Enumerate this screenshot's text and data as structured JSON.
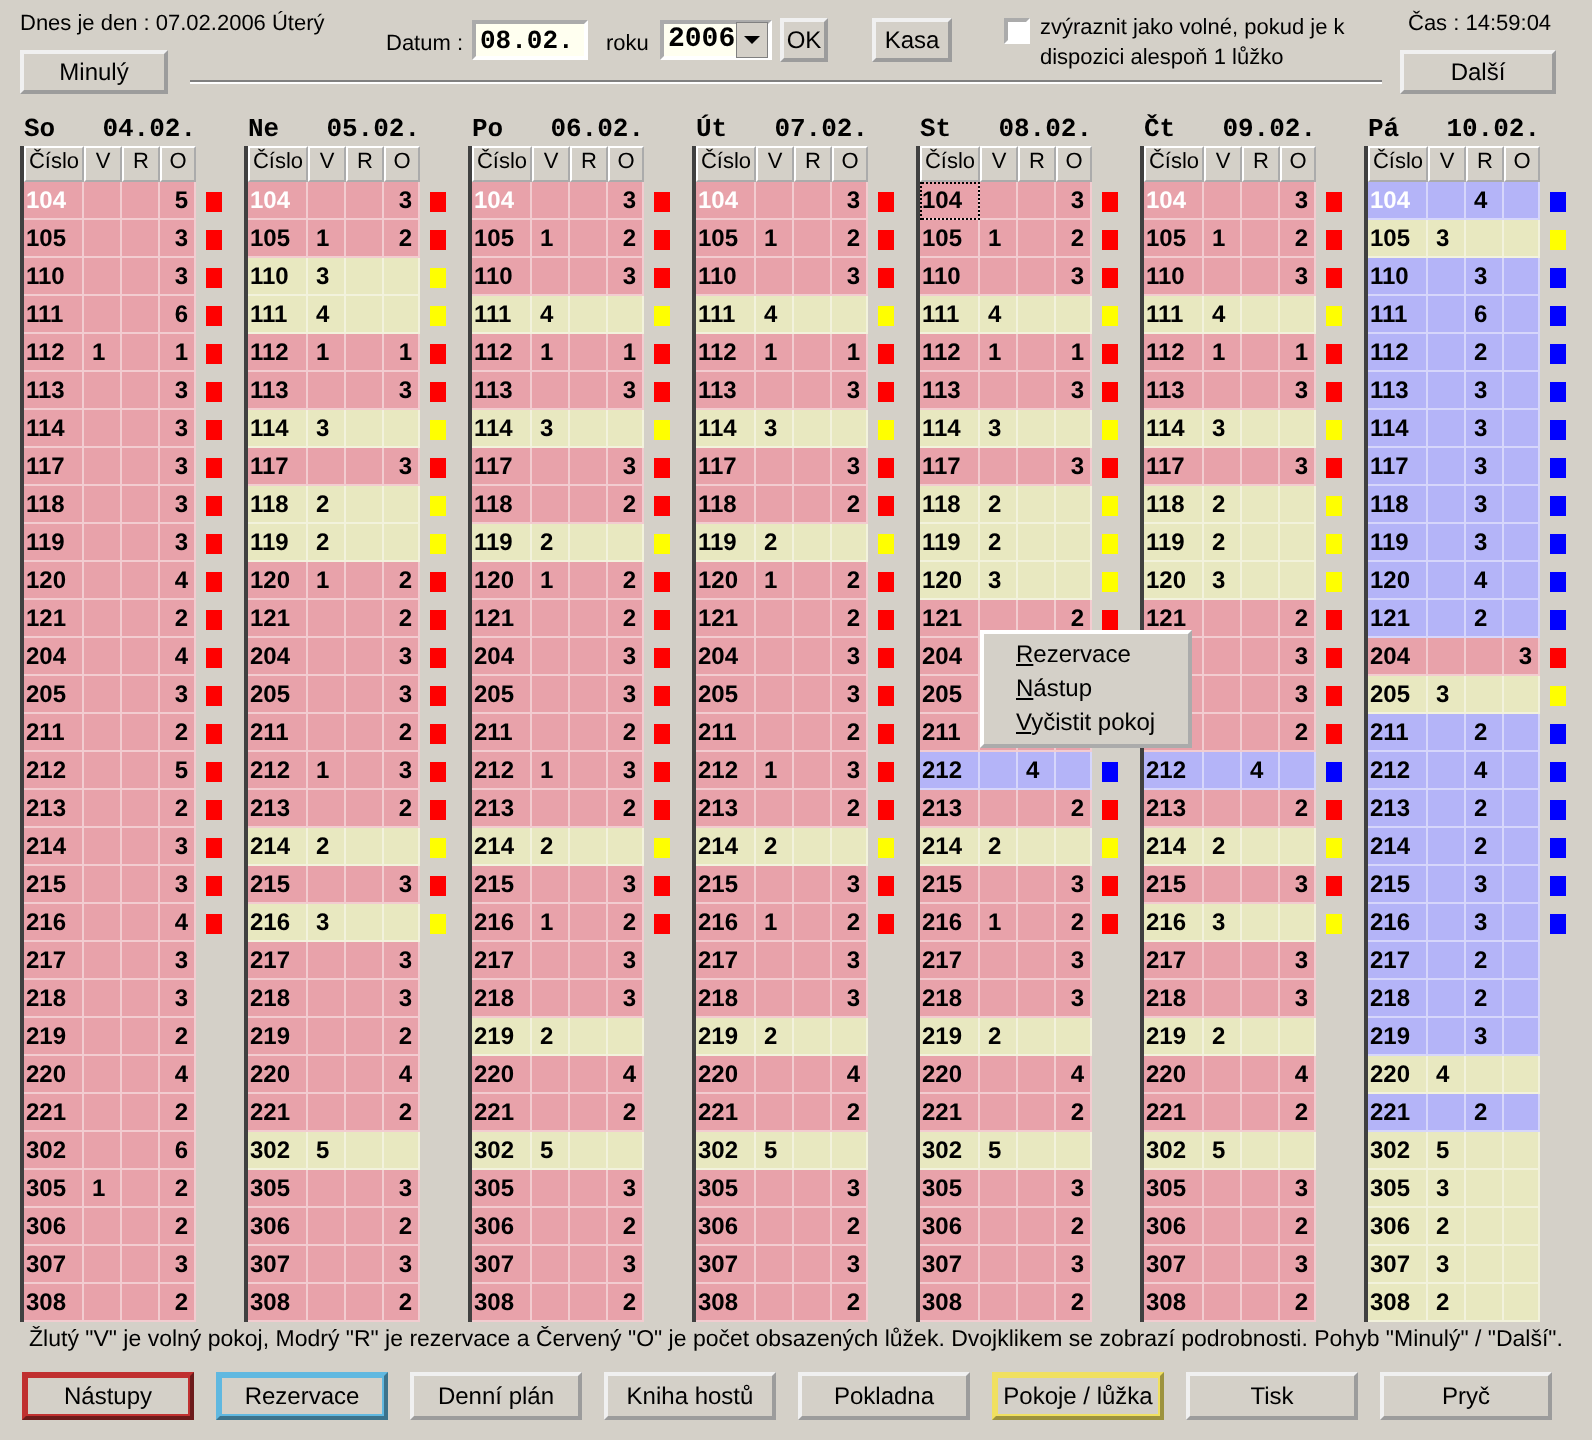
{
  "header": {
    "today": "Dnes je den : 07.02.2006  Úterý",
    "date_label": "Datum :",
    "date_value": "08.02.",
    "year_label": "roku",
    "year_value": "2006",
    "ok": "OK",
    "kasa": "Kasa",
    "highlight_checkbox": {
      "label": "zvýraznit jako volné, pokud je k dispozici alespoň 1 lůžko",
      "checked": false
    },
    "time": "Čas : 14:59:04",
    "prev": "Minulý",
    "next": "Další"
  },
  "days": [
    {
      "name": "So",
      "date": "04.02.",
      "columns": [
        "Číslo",
        "V",
        "R",
        "O"
      ],
      "rows": [
        {
          "room": "104",
          "o": "5",
          "kind": "occupied",
          "selected": true,
          "focused": false,
          "marker": true
        },
        {
          "room": "105",
          "o": "3",
          "kind": "occupied",
          "selected": false,
          "focused": false,
          "marker": true
        },
        {
          "room": "110",
          "o": "3",
          "kind": "occupied",
          "selected": false,
          "focused": false,
          "marker": true
        },
        {
          "room": "111",
          "o": "6",
          "kind": "occupied",
          "selected": false,
          "focused": false,
          "marker": true
        },
        {
          "room": "112",
          "v": "1",
          "o": "1",
          "kind": "occupied",
          "selected": false,
          "focused": false,
          "marker": true
        },
        {
          "room": "113",
          "o": "3",
          "kind": "occupied",
          "selected": false,
          "focused": false,
          "marker": true
        },
        {
          "room": "114",
          "o": "3",
          "kind": "occupied",
          "selected": false,
          "focused": false,
          "marker": true
        },
        {
          "room": "117",
          "o": "3",
          "kind": "occupied",
          "selected": false,
          "focused": false,
          "marker": true
        },
        {
          "room": "118",
          "o": "3",
          "kind": "occupied",
          "selected": false,
          "focused": false,
          "marker": true
        },
        {
          "room": "119",
          "o": "3",
          "kind": "occupied",
          "selected": false,
          "focused": false,
          "marker": true
        },
        {
          "room": "120",
          "o": "4",
          "kind": "occupied",
          "selected": false,
          "focused": false,
          "marker": true
        },
        {
          "room": "121",
          "o": "2",
          "kind": "occupied",
          "selected": false,
          "focused": false,
          "marker": true
        },
        {
          "room": "204",
          "o": "4",
          "kind": "occupied",
          "selected": false,
          "focused": false,
          "marker": true
        },
        {
          "room": "205",
          "o": "3",
          "kind": "occupied",
          "selected": false,
          "focused": false,
          "marker": true
        },
        {
          "room": "211",
          "o": "2",
          "kind": "occupied",
          "selected": false,
          "focused": false,
          "marker": true
        },
        {
          "room": "212",
          "o": "5",
          "kind": "occupied",
          "selected": false,
          "focused": false,
          "marker": true
        },
        {
          "room": "213",
          "o": "2",
          "kind": "occupied",
          "selected": false,
          "focused": false,
          "marker": true
        },
        {
          "room": "214",
          "o": "3",
          "kind": "occupied",
          "selected": false,
          "focused": false,
          "marker": true
        },
        {
          "room": "215",
          "o": "3",
          "kind": "occupied",
          "selected": false,
          "focused": false,
          "marker": true
        },
        {
          "room": "216",
          "o": "4",
          "kind": "occupied",
          "selected": false,
          "focused": false,
          "marker": true
        },
        {
          "room": "217",
          "o": "3",
          "kind": "occupied",
          "selected": false,
          "focused": false,
          "marker": false
        },
        {
          "room": "218",
          "o": "3",
          "kind": "occupied",
          "selected": false,
          "focused": false,
          "marker": false
        },
        {
          "room": "219",
          "o": "2",
          "kind": "occupied",
          "selected": false,
          "focused": false,
          "marker": false
        },
        {
          "room": "220",
          "o": "4",
          "kind": "occupied",
          "selected": false,
          "focused": false,
          "marker": false
        },
        {
          "room": "221",
          "o": "2",
          "kind": "occupied",
          "selected": false,
          "focused": false,
          "marker": false
        },
        {
          "room": "302",
          "o": "6",
          "kind": "occupied",
          "selected": false,
          "focused": false,
          "marker": false
        },
        {
          "room": "305",
          "v": "1",
          "o": "2",
          "kind": "occupied",
          "selected": false,
          "focused": false,
          "marker": false
        },
        {
          "room": "306",
          "o": "2",
          "kind": "occupied",
          "selected": false,
          "focused": false,
          "marker": false
        },
        {
          "room": "307",
          "o": "3",
          "kind": "occupied",
          "selected": false,
          "focused": false,
          "marker": false
        },
        {
          "room": "308",
          "o": "2",
          "kind": "occupied",
          "selected": false,
          "focused": false,
          "marker": false
        }
      ]
    },
    {
      "name": "Ne",
      "date": "05.02.",
      "columns": [
        "Číslo",
        "V",
        "R",
        "O"
      ],
      "rows": [
        {
          "room": "104",
          "o": "3",
          "kind": "occupied",
          "selected": true,
          "focused": false,
          "marker": true
        },
        {
          "room": "105",
          "v": "1",
          "o": "2",
          "kind": "occupied",
          "selected": false,
          "focused": false,
          "marker": true
        },
        {
          "room": "110",
          "v": "3",
          "kind": "free",
          "selected": false,
          "focused": false,
          "marker": true
        },
        {
          "room": "111",
          "v": "4",
          "kind": "free",
          "selected": false,
          "focused": false,
          "marker": true
        },
        {
          "room": "112",
          "v": "1",
          "o": "1",
          "kind": "occupied",
          "selected": false,
          "focused": false,
          "marker": true
        },
        {
          "room": "113",
          "o": "3",
          "kind": "occupied",
          "selected": false,
          "focused": false,
          "marker": true
        },
        {
          "room": "114",
          "v": "3",
          "kind": "free",
          "selected": false,
          "focused": false,
          "marker": true
        },
        {
          "room": "117",
          "o": "3",
          "kind": "occupied",
          "selected": false,
          "focused": false,
          "marker": true
        },
        {
          "room": "118",
          "v": "2",
          "kind": "free",
          "selected": false,
          "focused": false,
          "marker": true
        },
        {
          "room": "119",
          "v": "2",
          "kind": "free",
          "selected": false,
          "focused": false,
          "marker": true
        },
        {
          "room": "120",
          "v": "1",
          "o": "2",
          "kind": "occupied",
          "selected": false,
          "focused": false,
          "marker": true
        },
        {
          "room": "121",
          "o": "2",
          "kind": "occupied",
          "selected": false,
          "focused": false,
          "marker": true
        },
        {
          "room": "204",
          "o": "3",
          "kind": "occupied",
          "selected": false,
          "focused": false,
          "marker": true
        },
        {
          "room": "205",
          "o": "3",
          "kind": "occupied",
          "selected": false,
          "focused": false,
          "marker": true
        },
        {
          "room": "211",
          "o": "2",
          "kind": "occupied",
          "selected": false,
          "focused": false,
          "marker": true
        },
        {
          "room": "212",
          "v": "1",
          "o": "3",
          "kind": "occupied",
          "selected": false,
          "focused": false,
          "marker": true
        },
        {
          "room": "213",
          "o": "2",
          "kind": "occupied",
          "selected": false,
          "focused": false,
          "marker": true
        },
        {
          "room": "214",
          "v": "2",
          "kind": "free",
          "selected": false,
          "focused": false,
          "marker": true
        },
        {
          "room": "215",
          "o": "3",
          "kind": "occupied",
          "selected": false,
          "focused": false,
          "marker": true
        },
        {
          "room": "216",
          "v": "3",
          "kind": "free",
          "selected": false,
          "focused": false,
          "marker": true
        },
        {
          "room": "217",
          "o": "3",
          "kind": "occupied",
          "selected": false,
          "focused": false,
          "marker": false
        },
        {
          "room": "218",
          "o": "3",
          "kind": "occupied",
          "selected": false,
          "focused": false,
          "marker": false
        },
        {
          "room": "219",
          "o": "2",
          "kind": "occupied",
          "selected": false,
          "focused": false,
          "marker": false
        },
        {
          "room": "220",
          "o": "4",
          "kind": "occupied",
          "selected": false,
          "focused": false,
          "marker": false
        },
        {
          "room": "221",
          "o": "2",
          "kind": "occupied",
          "selected": false,
          "focused": false,
          "marker": false
        },
        {
          "room": "302",
          "v": "5",
          "kind": "free",
          "selected": false,
          "focused": false,
          "marker": false
        },
        {
          "room": "305",
          "o": "3",
          "kind": "occupied",
          "selected": false,
          "focused": false,
          "marker": false
        },
        {
          "room": "306",
          "o": "2",
          "kind": "occupied",
          "selected": false,
          "focused": false,
          "marker": false
        },
        {
          "room": "307",
          "o": "3",
          "kind": "occupied",
          "selected": false,
          "focused": false,
          "marker": false
        },
        {
          "room": "308",
          "o": "2",
          "kind": "occupied",
          "selected": false,
          "focused": false,
          "marker": false
        }
      ]
    },
    {
      "name": "Po",
      "date": "06.02.",
      "columns": [
        "Číslo",
        "V",
        "R",
        "O"
      ],
      "rows": [
        {
          "room": "104",
          "o": "3",
          "kind": "occupied",
          "selected": true,
          "focused": false,
          "marker": true
        },
        {
          "room": "105",
          "v": "1",
          "o": "2",
          "kind": "occupied",
          "selected": false,
          "focused": false,
          "marker": true
        },
        {
          "room": "110",
          "o": "3",
          "kind": "occupied",
          "selected": false,
          "focused": false,
          "marker": true
        },
        {
          "room": "111",
          "v": "4",
          "kind": "free",
          "selected": false,
          "focused": false,
          "marker": true
        },
        {
          "room": "112",
          "v": "1",
          "o": "1",
          "kind": "occupied",
          "selected": false,
          "focused": false,
          "marker": true
        },
        {
          "room": "113",
          "o": "3",
          "kind": "occupied",
          "selected": false,
          "focused": false,
          "marker": true
        },
        {
          "room": "114",
          "v": "3",
          "kind": "free",
          "selected": false,
          "focused": false,
          "marker": true
        },
        {
          "room": "117",
          "o": "3",
          "kind": "occupied",
          "selected": false,
          "focused": false,
          "marker": true
        },
        {
          "room": "118",
          "o": "2",
          "kind": "occupied",
          "selected": false,
          "focused": false,
          "marker": true
        },
        {
          "room": "119",
          "v": "2",
          "kind": "free",
          "selected": false,
          "focused": false,
          "marker": true
        },
        {
          "room": "120",
          "v": "1",
          "o": "2",
          "kind": "occupied",
          "selected": false,
          "focused": false,
          "marker": true
        },
        {
          "room": "121",
          "o": "2",
          "kind": "occupied",
          "selected": false,
          "focused": false,
          "marker": true
        },
        {
          "room": "204",
          "o": "3",
          "kind": "occupied",
          "selected": false,
          "focused": false,
          "marker": true
        },
        {
          "room": "205",
          "o": "3",
          "kind": "occupied",
          "selected": false,
          "focused": false,
          "marker": true
        },
        {
          "room": "211",
          "o": "2",
          "kind": "occupied",
          "selected": false,
          "focused": false,
          "marker": true
        },
        {
          "room": "212",
          "v": "1",
          "o": "3",
          "kind": "occupied",
          "selected": false,
          "focused": false,
          "marker": true
        },
        {
          "room": "213",
          "o": "2",
          "kind": "occupied",
          "selected": false,
          "focused": false,
          "marker": true
        },
        {
          "room": "214",
          "v": "2",
          "kind": "free",
          "selected": false,
          "focused": false,
          "marker": true
        },
        {
          "room": "215",
          "o": "3",
          "kind": "occupied",
          "selected": false,
          "focused": false,
          "marker": true
        },
        {
          "room": "216",
          "v": "1",
          "o": "2",
          "kind": "occupied",
          "selected": false,
          "focused": false,
          "marker": true
        },
        {
          "room": "217",
          "o": "3",
          "kind": "occupied",
          "selected": false,
          "focused": false,
          "marker": false
        },
        {
          "room": "218",
          "o": "3",
          "kind": "occupied",
          "selected": false,
          "focused": false,
          "marker": false
        },
        {
          "room": "219",
          "v": "2",
          "kind": "free",
          "selected": false,
          "focused": false,
          "marker": false
        },
        {
          "room": "220",
          "o": "4",
          "kind": "occupied",
          "selected": false,
          "focused": false,
          "marker": false
        },
        {
          "room": "221",
          "o": "2",
          "kind": "occupied",
          "selected": false,
          "focused": false,
          "marker": false
        },
        {
          "room": "302",
          "v": "5",
          "kind": "free",
          "selected": false,
          "focused": false,
          "marker": false
        },
        {
          "room": "305",
          "o": "3",
          "kind": "occupied",
          "selected": false,
          "focused": false,
          "marker": false
        },
        {
          "room": "306",
          "o": "2",
          "kind": "occupied",
          "selected": false,
          "focused": false,
          "marker": false
        },
        {
          "room": "307",
          "o": "3",
          "kind": "occupied",
          "selected": false,
          "focused": false,
          "marker": false
        },
        {
          "room": "308",
          "o": "2",
          "kind": "occupied",
          "selected": false,
          "focused": false,
          "marker": false
        }
      ]
    },
    {
      "name": "Út",
      "date": "07.02.",
      "columns": [
        "Číslo",
        "V",
        "R",
        "O"
      ],
      "rows": [
        {
          "room": "104",
          "o": "3",
          "kind": "occupied",
          "selected": true,
          "focused": false,
          "marker": true
        },
        {
          "room": "105",
          "v": "1",
          "o": "2",
          "kind": "occupied",
          "selected": false,
          "focused": false,
          "marker": true
        },
        {
          "room": "110",
          "o": "3",
          "kind": "occupied",
          "selected": false,
          "focused": false,
          "marker": true
        },
        {
          "room": "111",
          "v": "4",
          "kind": "free",
          "selected": false,
          "focused": false,
          "marker": true
        },
        {
          "room": "112",
          "v": "1",
          "o": "1",
          "kind": "occupied",
          "selected": false,
          "focused": false,
          "marker": true
        },
        {
          "room": "113",
          "o": "3",
          "kind": "occupied",
          "selected": false,
          "focused": false,
          "marker": true
        },
        {
          "room": "114",
          "v": "3",
          "kind": "free",
          "selected": false,
          "focused": false,
          "marker": true
        },
        {
          "room": "117",
          "o": "3",
          "kind": "occupied",
          "selected": false,
          "focused": false,
          "marker": true
        },
        {
          "room": "118",
          "o": "2",
          "kind": "occupied",
          "selected": false,
          "focused": false,
          "marker": true
        },
        {
          "room": "119",
          "v": "2",
          "kind": "free",
          "selected": false,
          "focused": false,
          "marker": true
        },
        {
          "room": "120",
          "v": "1",
          "o": "2",
          "kind": "occupied",
          "selected": false,
          "focused": false,
          "marker": true
        },
        {
          "room": "121",
          "o": "2",
          "kind": "occupied",
          "selected": false,
          "focused": false,
          "marker": true
        },
        {
          "room": "204",
          "o": "3",
          "kind": "occupied",
          "selected": false,
          "focused": false,
          "marker": true
        },
        {
          "room": "205",
          "o": "3",
          "kind": "occupied",
          "selected": false,
          "focused": false,
          "marker": true
        },
        {
          "room": "211",
          "o": "2",
          "kind": "occupied",
          "selected": false,
          "focused": false,
          "marker": true
        },
        {
          "room": "212",
          "v": "1",
          "o": "3",
          "kind": "occupied",
          "selected": false,
          "focused": false,
          "marker": true
        },
        {
          "room": "213",
          "o": "2",
          "kind": "occupied",
          "selected": false,
          "focused": false,
          "marker": true
        },
        {
          "room": "214",
          "v": "2",
          "kind": "free",
          "selected": false,
          "focused": false,
          "marker": true
        },
        {
          "room": "215",
          "o": "3",
          "kind": "occupied",
          "selected": false,
          "focused": false,
          "marker": true
        },
        {
          "room": "216",
          "v": "1",
          "o": "2",
          "kind": "occupied",
          "selected": false,
          "focused": false,
          "marker": true
        },
        {
          "room": "217",
          "o": "3",
          "kind": "occupied",
          "selected": false,
          "focused": false,
          "marker": false
        },
        {
          "room": "218",
          "o": "3",
          "kind": "occupied",
          "selected": false,
          "focused": false,
          "marker": false
        },
        {
          "room": "219",
          "v": "2",
          "kind": "free",
          "selected": false,
          "focused": false,
          "marker": false
        },
        {
          "room": "220",
          "o": "4",
          "kind": "occupied",
          "selected": false,
          "focused": false,
          "marker": false
        },
        {
          "room": "221",
          "o": "2",
          "kind": "occupied",
          "selected": false,
          "focused": false,
          "marker": false
        },
        {
          "room": "302",
          "v": "5",
          "kind": "free",
          "selected": false,
          "focused": false,
          "marker": false
        },
        {
          "room": "305",
          "o": "3",
          "kind": "occupied",
          "selected": false,
          "focused": false,
          "marker": false
        },
        {
          "room": "306",
          "o": "2",
          "kind": "occupied",
          "selected": false,
          "focused": false,
          "marker": false
        },
        {
          "room": "307",
          "o": "3",
          "kind": "occupied",
          "selected": false,
          "focused": false,
          "marker": false
        },
        {
          "room": "308",
          "o": "2",
          "kind": "occupied",
          "selected": false,
          "focused": false,
          "marker": false
        }
      ]
    },
    {
      "name": "St",
      "date": "08.02.",
      "columns": [
        "Číslo",
        "V",
        "R",
        "O"
      ],
      "rows": [
        {
          "room": "104",
          "o": "3",
          "kind": "occupied",
          "selected": false,
          "focused": true,
          "marker": true
        },
        {
          "room": "105",
          "v": "1",
          "o": "2",
          "kind": "occupied",
          "selected": false,
          "focused": false,
          "marker": true
        },
        {
          "room": "110",
          "o": "3",
          "kind": "occupied",
          "selected": false,
          "focused": false,
          "marker": true
        },
        {
          "room": "111",
          "v": "4",
          "kind": "free",
          "selected": false,
          "focused": false,
          "marker": true
        },
        {
          "room": "112",
          "v": "1",
          "o": "1",
          "kind": "occupied",
          "selected": false,
          "focused": false,
          "marker": true
        },
        {
          "room": "113",
          "o": "3",
          "kind": "occupied",
          "selected": false,
          "focused": false,
          "marker": true
        },
        {
          "room": "114",
          "v": "3",
          "kind": "free",
          "selected": false,
          "focused": false,
          "marker": true
        },
        {
          "room": "117",
          "o": "3",
          "kind": "occupied",
          "selected": false,
          "focused": false,
          "marker": true
        },
        {
          "room": "118",
          "v": "2",
          "kind": "free",
          "selected": false,
          "focused": false,
          "marker": true
        },
        {
          "room": "119",
          "v": "2",
          "kind": "free",
          "selected": false,
          "focused": false,
          "marker": true
        },
        {
          "room": "120",
          "v": "3",
          "kind": "free",
          "selected": false,
          "focused": false,
          "marker": true
        },
        {
          "room": "121",
          "o": "2",
          "kind": "occupied",
          "selected": false,
          "focused": false,
          "marker": true
        },
        {
          "room": "204",
          "kind": "occupied",
          "selected": false,
          "focused": false,
          "marker": false
        },
        {
          "room": "205",
          "kind": "occupied",
          "selected": false,
          "focused": false,
          "marker": false
        },
        {
          "room": "211",
          "kind": "occupied",
          "selected": false,
          "focused": false,
          "marker": false
        },
        {
          "room": "212",
          "r": "4",
          "kind": "reserved",
          "selected": false,
          "focused": false,
          "marker": true
        },
        {
          "room": "213",
          "o": "2",
          "kind": "occupied",
          "selected": false,
          "focused": false,
          "marker": true
        },
        {
          "room": "214",
          "v": "2",
          "kind": "free",
          "selected": false,
          "focused": false,
          "marker": true
        },
        {
          "room": "215",
          "o": "3",
          "kind": "occupied",
          "selected": false,
          "focused": false,
          "marker": true
        },
        {
          "room": "216",
          "v": "1",
          "o": "2",
          "kind": "occupied",
          "selected": false,
          "focused": false,
          "marker": true
        },
        {
          "room": "217",
          "o": "3",
          "kind": "occupied",
          "selected": false,
          "focused": false,
          "marker": false
        },
        {
          "room": "218",
          "o": "3",
          "kind": "occupied",
          "selected": false,
          "focused": false,
          "marker": false
        },
        {
          "room": "219",
          "v": "2",
          "kind": "free",
          "selected": false,
          "focused": false,
          "marker": false
        },
        {
          "room": "220",
          "o": "4",
          "kind": "occupied",
          "selected": false,
          "focused": false,
          "marker": false
        },
        {
          "room": "221",
          "o": "2",
          "kind": "occupied",
          "selected": false,
          "focused": false,
          "marker": false
        },
        {
          "room": "302",
          "v": "5",
          "kind": "free",
          "selected": false,
          "focused": false,
          "marker": false
        },
        {
          "room": "305",
          "o": "3",
          "kind": "occupied",
          "selected": false,
          "focused": false,
          "marker": false
        },
        {
          "room": "306",
          "o": "2",
          "kind": "occupied",
          "selected": false,
          "focused": false,
          "marker": false
        },
        {
          "room": "307",
          "o": "3",
          "kind": "occupied",
          "selected": false,
          "focused": false,
          "marker": false
        },
        {
          "room": "308",
          "o": "2",
          "kind": "occupied",
          "selected": false,
          "focused": false,
          "marker": false
        }
      ]
    },
    {
      "name": "Čt",
      "date": "09.02.",
      "columns": [
        "Číslo",
        "V",
        "R",
        "O"
      ],
      "rows": [
        {
          "room": "104",
          "o": "3",
          "kind": "occupied",
          "selected": true,
          "focused": false,
          "marker": true
        },
        {
          "room": "105",
          "v": "1",
          "o": "2",
          "kind": "occupied",
          "selected": false,
          "focused": false,
          "marker": true
        },
        {
          "room": "110",
          "o": "3",
          "kind": "occupied",
          "selected": false,
          "focused": false,
          "marker": true
        },
        {
          "room": "111",
          "v": "4",
          "kind": "free",
          "selected": false,
          "focused": false,
          "marker": true
        },
        {
          "room": "112",
          "v": "1",
          "o": "1",
          "kind": "occupied",
          "selected": false,
          "focused": false,
          "marker": true
        },
        {
          "room": "113",
          "o": "3",
          "kind": "occupied",
          "selected": false,
          "focused": false,
          "marker": true
        },
        {
          "room": "114",
          "v": "3",
          "kind": "free",
          "selected": false,
          "focused": false,
          "marker": true
        },
        {
          "room": "117",
          "o": "3",
          "kind": "occupied",
          "selected": false,
          "focused": false,
          "marker": true
        },
        {
          "room": "118",
          "v": "2",
          "kind": "free",
          "selected": false,
          "focused": false,
          "marker": true
        },
        {
          "room": "119",
          "v": "2",
          "kind": "free",
          "selected": false,
          "focused": false,
          "marker": true
        },
        {
          "room": "120",
          "v": "3",
          "kind": "free",
          "selected": false,
          "focused": false,
          "marker": true
        },
        {
          "room": "121",
          "o": "2",
          "kind": "occupied",
          "selected": false,
          "focused": false,
          "marker": true
        },
        {
          "o": "3",
          "kind": "occupied",
          "marker": true
        },
        {
          "o": "3",
          "kind": "occupied",
          "marker": true
        },
        {
          "o": "2",
          "kind": "occupied",
          "marker": true
        },
        {
          "room": "212",
          "r": "4",
          "kind": "reserved",
          "selected": false,
          "focused": false,
          "marker": true
        },
        {
          "room": "213",
          "o": "2",
          "kind": "occupied",
          "selected": false,
          "focused": false,
          "marker": true
        },
        {
          "room": "214",
          "v": "2",
          "kind": "free",
          "selected": false,
          "focused": false,
          "marker": true
        },
        {
          "room": "215",
          "o": "3",
          "kind": "occupied",
          "selected": false,
          "focused": false,
          "marker": true
        },
        {
          "room": "216",
          "v": "3",
          "kind": "free",
          "selected": false,
          "focused": false,
          "marker": true
        },
        {
          "room": "217",
          "o": "3",
          "kind": "occupied",
          "selected": false,
          "focused": false,
          "marker": false
        },
        {
          "room": "218",
          "o": "3",
          "kind": "occupied",
          "selected": false,
          "focused": false,
          "marker": false
        },
        {
          "room": "219",
          "v": "2",
          "kind": "free",
          "selected": false,
          "focused": false,
          "marker": false
        },
        {
          "room": "220",
          "o": "4",
          "kind": "occupied",
          "selected": false,
          "focused": false,
          "marker": false
        },
        {
          "room": "221",
          "o": "2",
          "kind": "occupied",
          "selected": false,
          "focused": false,
          "marker": false
        },
        {
          "room": "302",
          "v": "5",
          "kind": "free",
          "selected": false,
          "focused": false,
          "marker": false
        },
        {
          "room": "305",
          "o": "3",
          "kind": "occupied",
          "selected": false,
          "focused": false,
          "marker": false
        },
        {
          "room": "306",
          "o": "2",
          "kind": "occupied",
          "selected": false,
          "focused": false,
          "marker": false
        },
        {
          "room": "307",
          "o": "3",
          "kind": "occupied",
          "selected": false,
          "focused": false,
          "marker": false
        },
        {
          "room": "308",
          "o": "2",
          "kind": "occupied",
          "selected": false,
          "focused": false,
          "marker": false
        }
      ]
    },
    {
      "name": "Pá",
      "date": "10.02.",
      "columns": [
        "Číslo",
        "V",
        "R",
        "O"
      ],
      "rows": [
        {
          "room": "104",
          "r": "4",
          "kind": "reserved",
          "selected": true,
          "focused": false,
          "marker": true
        },
        {
          "room": "105",
          "v": "3",
          "kind": "free",
          "selected": false,
          "focused": false,
          "marker": true
        },
        {
          "room": "110",
          "r": "3",
          "kind": "reserved",
          "selected": false,
          "focused": false,
          "marker": true
        },
        {
          "room": "111",
          "r": "6",
          "kind": "reserved",
          "selected": false,
          "focused": false,
          "marker": true
        },
        {
          "room": "112",
          "r": "2",
          "kind": "reserved",
          "selected": false,
          "focused": false,
          "marker": true
        },
        {
          "room": "113",
          "r": "3",
          "kind": "reserved",
          "selected": false,
          "focused": false,
          "marker": true
        },
        {
          "room": "114",
          "r": "3",
          "kind": "reserved",
          "selected": false,
          "focused": false,
          "marker": true
        },
        {
          "room": "117",
          "r": "3",
          "kind": "reserved",
          "selected": false,
          "focused": false,
          "marker": true
        },
        {
          "room": "118",
          "r": "3",
          "kind": "reserved",
          "selected": false,
          "focused": false,
          "marker": true
        },
        {
          "room": "119",
          "r": "3",
          "kind": "reserved",
          "selected": false,
          "focused": false,
          "marker": true
        },
        {
          "room": "120",
          "r": "4",
          "kind": "reserved",
          "selected": false,
          "focused": false,
          "marker": true
        },
        {
          "room": "121",
          "r": "2",
          "kind": "reserved",
          "selected": false,
          "focused": false,
          "marker": true
        },
        {
          "room": "204",
          "o": "3",
          "kind": "occupied",
          "selected": false,
          "focused": false,
          "marker": true
        },
        {
          "room": "205",
          "v": "3",
          "kind": "free",
          "selected": false,
          "focused": false,
          "marker": true
        },
        {
          "room": "211",
          "r": "2",
          "kind": "reserved",
          "selected": false,
          "focused": false,
          "marker": true
        },
        {
          "room": "212",
          "r": "4",
          "kind": "reserved",
          "selected": false,
          "focused": false,
          "marker": true
        },
        {
          "room": "213",
          "r": "2",
          "kind": "reserved",
          "selected": false,
          "focused": false,
          "marker": true
        },
        {
          "room": "214",
          "r": "2",
          "kind": "reserved",
          "selected": false,
          "focused": false,
          "marker": true
        },
        {
          "room": "215",
          "r": "3",
          "kind": "reserved",
          "selected": false,
          "focused": false,
          "marker": true
        },
        {
          "room": "216",
          "r": "3",
          "kind": "reserved",
          "selected": false,
          "focused": false,
          "marker": true
        },
        {
          "room": "217",
          "r": "2",
          "kind": "reserved",
          "selected": false,
          "focused": false,
          "marker": false
        },
        {
          "room": "218",
          "r": "2",
          "kind": "reserved",
          "selected": false,
          "focused": false,
          "marker": false
        },
        {
          "room": "219",
          "r": "3",
          "kind": "reserved",
          "selected": false,
          "focused": false,
          "marker": false
        },
        {
          "room": "220",
          "v": "4",
          "kind": "free",
          "selected": false,
          "focused": false,
          "marker": false
        },
        {
          "room": "221",
          "r": "2",
          "kind": "reserved",
          "selected": false,
          "focused": false,
          "marker": false
        },
        {
          "room": "302",
          "v": "5",
          "kind": "free",
          "selected": false,
          "focused": false,
          "marker": false
        },
        {
          "room": "305",
          "v": "3",
          "kind": "free",
          "selected": false,
          "focused": false,
          "marker": false
        },
        {
          "room": "306",
          "v": "2",
          "kind": "free",
          "selected": false,
          "focused": false,
          "marker": false
        },
        {
          "room": "307",
          "v": "3",
          "kind": "free",
          "selected": false,
          "focused": false,
          "marker": false
        },
        {
          "room": "308",
          "v": "2",
          "kind": "free",
          "selected": false,
          "focused": false,
          "marker": false
        }
      ]
    }
  ],
  "context_menu": [
    "Rezervace",
    "Nástup",
    "Vyčistit pokoj"
  ],
  "legend": "Žlutý \"V\" je volný pokoj, Modrý \"R\" je rezervace a Červený \"O\" je počet obsazených lůžek. Dvojklikem se zobrazí podrobnosti.  Pohyb \"Minulý\" / \"Další\".",
  "buttons": [
    {
      "label": "Nástupy",
      "color": "#c03030"
    },
    {
      "label": "Rezervace",
      "color": "#60b8e0"
    },
    {
      "label": "Denní plán"
    },
    {
      "label": "Kniha hostů"
    },
    {
      "label": "Pokladna"
    },
    {
      "label": "Pokoje / lůžka",
      "color": "#f0e060"
    },
    {
      "label": "Tisk"
    },
    {
      "label": "Pryč"
    }
  ]
}
